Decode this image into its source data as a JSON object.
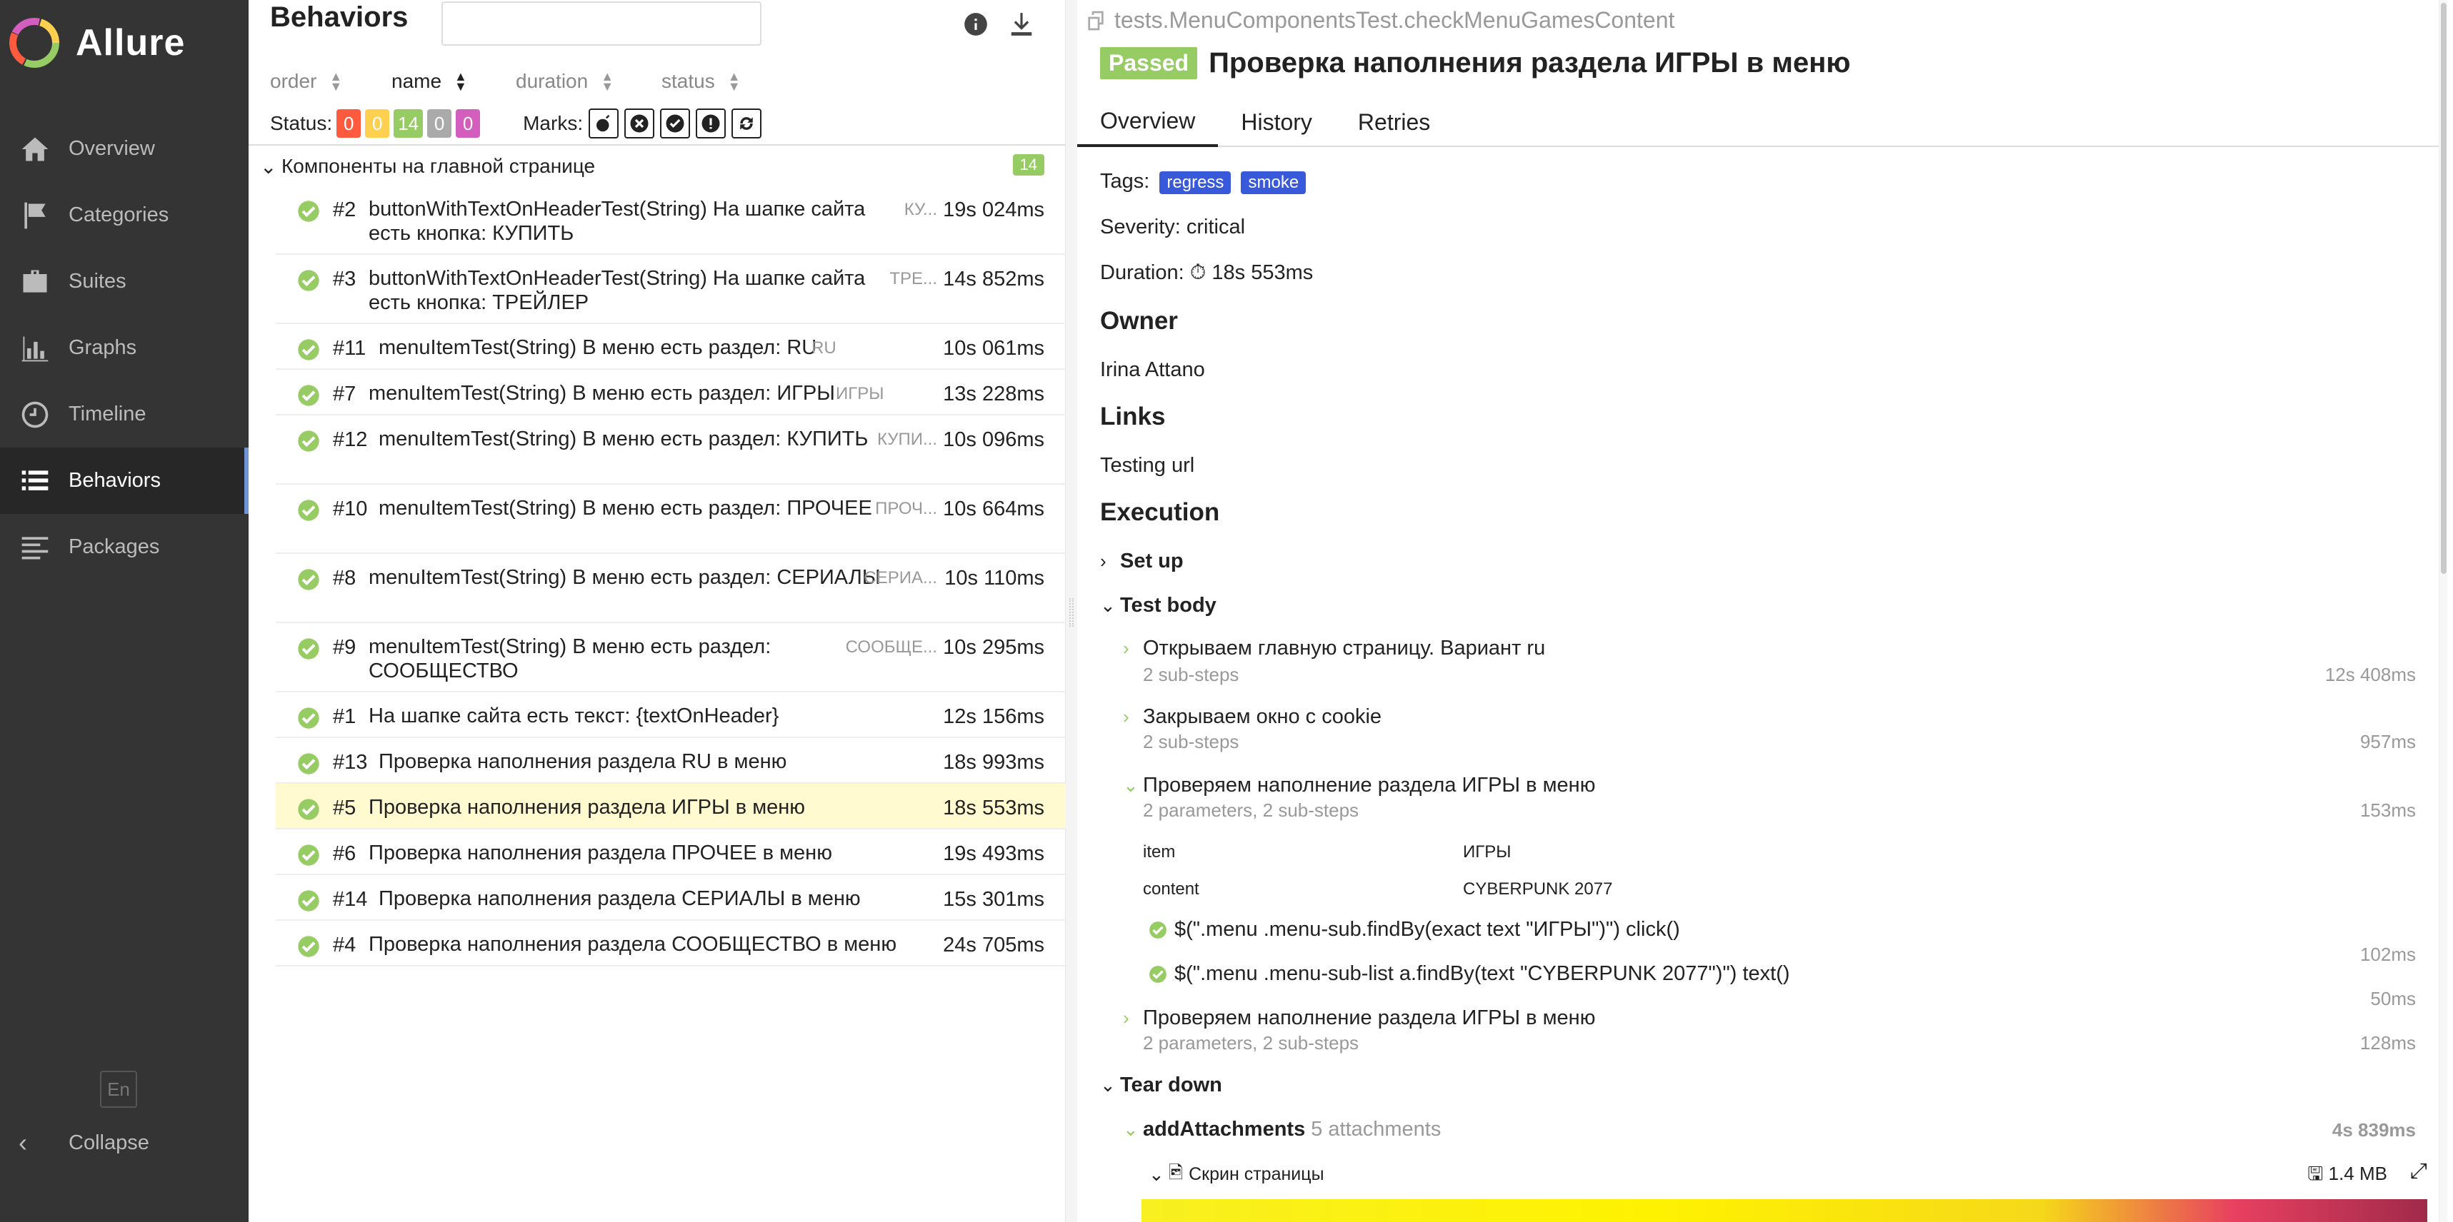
{
  "app": {
    "title": "Allure"
  },
  "sidebar": {
    "items": [
      {
        "label": "Overview",
        "icon": "home-icon"
      },
      {
        "label": "Categories",
        "icon": "flag-icon"
      },
      {
        "label": "Suites",
        "icon": "briefcase-icon"
      },
      {
        "label": "Graphs",
        "icon": "bar-chart-icon"
      },
      {
        "label": "Timeline",
        "icon": "clock-icon"
      },
      {
        "label": "Behaviors",
        "icon": "list-icon",
        "active": true
      },
      {
        "label": "Packages",
        "icon": "align-left-icon"
      }
    ],
    "lang": "En",
    "collapse": "Collapse"
  },
  "tree": {
    "title": "Behaviors",
    "search": {
      "value": "",
      "placeholder": ""
    },
    "sorters": {
      "order": "order",
      "name": "name",
      "duration": "duration",
      "status": "status"
    },
    "status_label": "Status:",
    "status_counts": {
      "failed": "0",
      "broken": "0",
      "passed": "14",
      "skipped": "0",
      "unknown": "0"
    },
    "marks_label": "Marks:",
    "group": {
      "name": "Компоненты на главной странице",
      "count": "14"
    },
    "rows": [
      {
        "num": "#2",
        "name": "buttonWithTextOnHeaderTest(String) На шапке сайта есть кнопка: КУПИТЬ",
        "param": "КУ...",
        "duration": "19s 024ms"
      },
      {
        "num": "#3",
        "name": "buttonWithTextOnHeaderTest(String) На шапке сайта есть кнопка: ТРЕЙЛЕР",
        "param": "ТРЕ...",
        "duration": "14s 852ms"
      },
      {
        "num": "#11",
        "name": "menuItemTest(String) В меню есть раздел: RU",
        "param": "RU",
        "duration": "10s 061ms"
      },
      {
        "num": "#7",
        "name": "menuItemTest(String) В меню есть раздел: ИГРЫ",
        "param": "ИГРЫ",
        "duration": "13s 228ms"
      },
      {
        "num": "#12",
        "name": "menuItemTest(String) В меню есть раздел: КУПИТЬ",
        "param": "КУПИ...",
        "duration": "10s 096ms"
      },
      {
        "num": "#10",
        "name": "menuItemTest(String) В меню есть раздел: ПРОЧЕЕ",
        "param": "ПРОЧ...",
        "duration": "10s 664ms"
      },
      {
        "num": "#8",
        "name": "menuItemTest(String) В меню есть раздел: СЕРИАЛЫ",
        "param": "СЕРИА...",
        "duration": "10s 110ms"
      },
      {
        "num": "#9",
        "name": "menuItemTest(String) В меню есть раздел: СООБЩЕСТВО",
        "param": "СООБЩЕ...",
        "duration": "10s 295ms"
      },
      {
        "num": "#1",
        "name": "На шапке сайта есть текст: {textOnHeader}",
        "param": "",
        "duration": "12s 156ms"
      },
      {
        "num": "#13",
        "name": "Проверка наполнения раздела RU в меню",
        "param": "",
        "duration": "18s 993ms"
      },
      {
        "num": "#5",
        "name": "Проверка наполнения раздела ИГРЫ в меню",
        "param": "",
        "duration": "18s 553ms",
        "selected": true
      },
      {
        "num": "#6",
        "name": "Проверка наполнения раздела ПРОЧЕЕ в меню",
        "param": "",
        "duration": "19s 493ms"
      },
      {
        "num": "#14",
        "name": "Проверка наполнения раздела СЕРИАЛЫ в меню",
        "param": "",
        "duration": "15s 301ms"
      },
      {
        "num": "#4",
        "name": "Проверка наполнения раздела СООБЩЕСТВО в меню",
        "param": "",
        "duration": "24s 705ms"
      }
    ]
  },
  "detail": {
    "fullname": "tests.MenuComponentsTest.checkMenuGamesContent",
    "status": "Passed",
    "title": "Проверка наполнения раздела ИГРЫ в меню",
    "tabs": [
      "Overview",
      "History",
      "Retries"
    ],
    "tags_label": "Tags:",
    "tags": [
      "regress",
      "smoke"
    ],
    "severity": "Severity: critical",
    "duration_label": "Duration:",
    "duration": "18s 553ms",
    "owner_h": "Owner",
    "owner": "Irina Attano",
    "links_h": "Links",
    "link": "Testing url",
    "execution_h": "Execution",
    "setup": "Set up",
    "testbody": "Test body",
    "steps": [
      {
        "name": "Открываем главную страницу. Вариант ru",
        "sub": "2 sub-steps",
        "duration": "12s 408ms"
      },
      {
        "name": "Закрываем окно с cookie",
        "sub": "2 sub-steps",
        "duration": "957ms"
      },
      {
        "name": "Проверяем наполнение раздела ИГРЫ в меню",
        "sub": "2 parameters, 2 sub-steps",
        "duration": "153ms"
      }
    ],
    "params": [
      {
        "name": "item",
        "value": "ИГРЫ"
      },
      {
        "name": "content",
        "value": "CYBERPUNK 2077"
      }
    ],
    "substeps": [
      {
        "name": "$(\".menu .menu-sub.findBy(exact text \"ИГРЫ\")\") click()",
        "duration": "102ms"
      },
      {
        "name": "$(\".menu .menu-sub-list a.findBy(text \"CYBERPUNK 2077\")\") text()",
        "duration": "50ms"
      }
    ],
    "step4": {
      "name": "Проверяем наполнение раздела ИГРЫ в меню",
      "sub": "2 parameters, 2 sub-steps",
      "duration": "128ms"
    },
    "teardown": "Tear down",
    "attach": {
      "name": "addAttachments",
      "count": "5 attachments",
      "duration": "4s 839ms"
    },
    "screenshot": {
      "name": "Скрин страницы",
      "size": "1.4 MB"
    }
  },
  "colors": {
    "passed": "#97cc64",
    "failed": "#fd5a3e",
    "broken": "#ffd050",
    "skipped": "#aaaaaa",
    "unknown": "#d35ebe",
    "tag": "#3859d9",
    "sidebar": "#343434"
  }
}
